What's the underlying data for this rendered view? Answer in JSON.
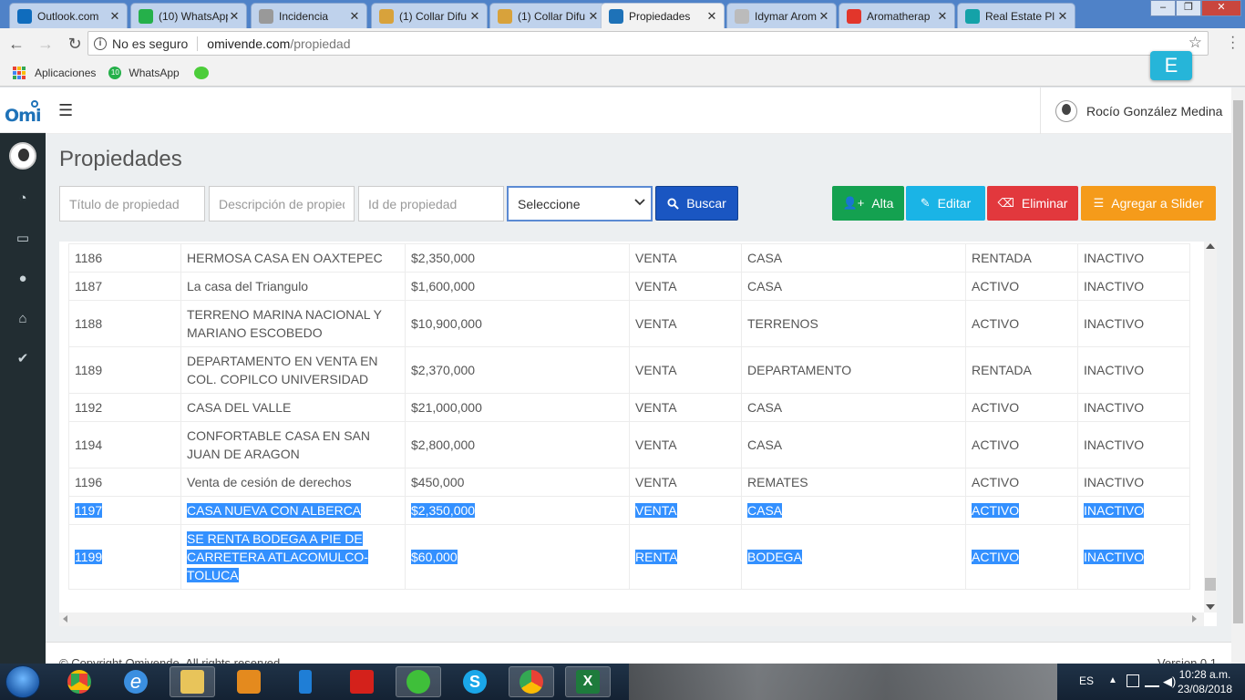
{
  "browser": {
    "tabs": [
      {
        "label": "Outlook.com",
        "favicon": "outlook-icon",
        "color": "#0f6cbd"
      },
      {
        "label": "(10) WhatsApp",
        "favicon": "whatsapp-icon",
        "color": "#25b04a"
      },
      {
        "label": "Incidencia",
        "favicon": "incidencia-icon",
        "color": "#999999"
      },
      {
        "label": "(1) Collar Difu",
        "favicon": "collar-icon",
        "color": "#d8a23b"
      },
      {
        "label": "(1) Collar Difu",
        "favicon": "collar-icon",
        "color": "#d8a23b"
      },
      {
        "label": "Propiedades",
        "favicon": "omi-icon",
        "color": "#1e72b8"
      },
      {
        "label": "Idymar Arom",
        "favicon": "page-icon",
        "color": "#bbbbbb"
      },
      {
        "label": "Aromatherap",
        "favicon": "aromatherapy-icon",
        "color": "#e2362b"
      },
      {
        "label": "Real Estate Pl",
        "favicon": "realestate-icon",
        "color": "#14a2a8"
      }
    ],
    "address": {
      "security": "No es seguro",
      "host": "omivende.com",
      "path": "/propiedad"
    },
    "bookmarks": {
      "apps": "Aplicaciones",
      "whatsapp": "WhatsApp",
      "wa_badge": "10"
    },
    "extension_letter": "E"
  },
  "app": {
    "logo": "Omi",
    "user_name": "Rocío González Medina",
    "page_title": "Propiedades",
    "filters": {
      "titulo_placeholder": "Título de propiedad",
      "descripcion_placeholder": "Descripción de propiedad",
      "id_placeholder": "Id de propiedad",
      "select_value": "Seleccione"
    },
    "buttons": {
      "buscar": "Buscar",
      "alta": "Alta",
      "editar": "Editar",
      "eliminar": "Eliminar",
      "slider": "Agregar a Slider"
    },
    "colors": {
      "buscar": "#1a56c2",
      "alta": "#14a150",
      "editar": "#1ab4e6",
      "eliminar": "#e2383d",
      "slider": "#f59b1a",
      "selection": "#3390ff"
    },
    "table": {
      "rows": [
        {
          "id": "1186",
          "titulo": "HERMOSA CASA EN OAXTEPEC",
          "precio": "$2,350,000",
          "operacion": "VENTA",
          "tipo": "CASA",
          "estado": "RENTADA",
          "status": "INACTIVO"
        },
        {
          "id": "1187",
          "titulo": "La casa del Triangulo",
          "precio": "$1,600,000",
          "operacion": "VENTA",
          "tipo": "CASA",
          "estado": "ACTIVO",
          "status": "INACTIVO"
        },
        {
          "id": "1188",
          "titulo": "TERRENO MARINA NACIONAL Y MARIANO ESCOBEDO",
          "precio": "$10,900,000",
          "operacion": "VENTA",
          "tipo": "TERRENOS",
          "estado": "ACTIVO",
          "status": "INACTIVO"
        },
        {
          "id": "1189",
          "titulo": "DEPARTAMENTO EN VENTA EN COL. COPILCO UNIVERSIDAD",
          "precio": "$2,370,000",
          "operacion": "VENTA",
          "tipo": "DEPARTAMENTO",
          "estado": "RENTADA",
          "status": "INACTIVO"
        },
        {
          "id": "1192",
          "titulo": "CASA DEL VALLE",
          "precio": "$21,000,000",
          "operacion": "VENTA",
          "tipo": "CASA",
          "estado": "ACTIVO",
          "status": "INACTIVO"
        },
        {
          "id": "1194",
          "titulo": "CONFORTABLE CASA EN SAN JUAN DE ARAGON",
          "precio": "$2,800,000",
          "operacion": "VENTA",
          "tipo": "CASA",
          "estado": "ACTIVO",
          "status": "INACTIVO"
        },
        {
          "id": "1196",
          "titulo": "Venta de cesión de derechos",
          "precio": "$450,000",
          "operacion": "VENTA",
          "tipo": "REMATES",
          "estado": "ACTIVO",
          "status": "INACTIVO"
        },
        {
          "id": "1197",
          "titulo": "CASA NUEVA CON ALBERCA",
          "precio": "$2,350,000",
          "operacion": "VENTA",
          "tipo": "CASA",
          "estado": "ACTIVO",
          "status": "INACTIVO"
        },
        {
          "id": "1199",
          "titulo": "SE RENTA BODEGA A PIE DE CARRETERA ATLACOMULCO-TOLUCA",
          "precio": "$60,000",
          "operacion": "RENTA",
          "tipo": "BODEGA",
          "estado": "ACTIVO",
          "status": "INACTIVO"
        }
      ]
    },
    "footer": {
      "copyright": "© Copyright Omivende. All rights reserved.",
      "version": "Version 0.1"
    }
  },
  "taskbar": {
    "tray_lang": "ES",
    "time": "10:28 a.m.",
    "date": "23/08/2018"
  }
}
